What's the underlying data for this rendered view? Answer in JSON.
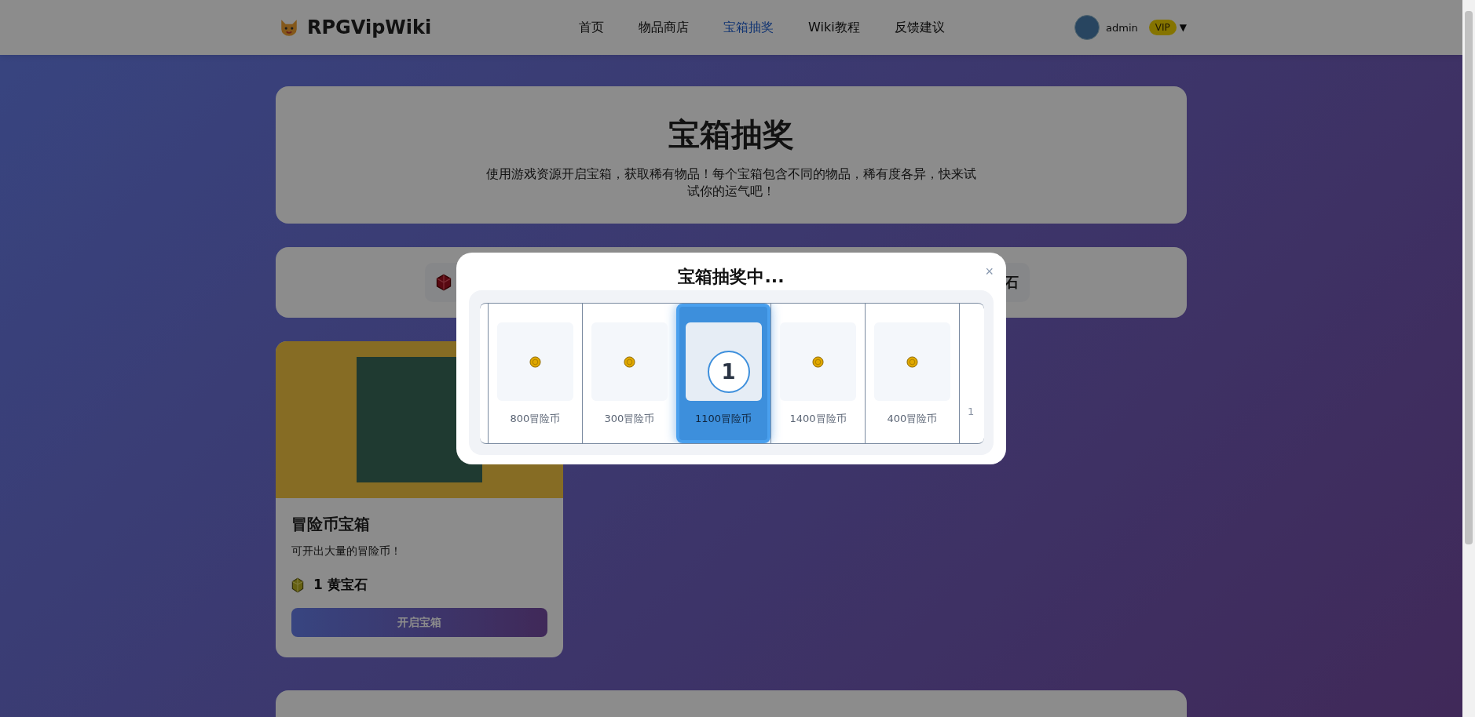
{
  "header": {
    "logo": "RPGVipWiki",
    "nav": [
      {
        "label": "首页",
        "selected": false
      },
      {
        "label": "物品商店",
        "selected": false
      },
      {
        "label": "宝箱抽奖",
        "selected": true
      },
      {
        "label": "Wiki教程",
        "selected": false
      },
      {
        "label": "反馈建议",
        "selected": false
      }
    ],
    "user": {
      "name": "admin",
      "badge": "VIP",
      "caret": "▼"
    }
  },
  "intro": {
    "title": "宝箱抽奖",
    "description": "使用游戏资源开启宝箱，获取稀有物品！每个宝箱包含不同的物品，稀有度各异，快来试试你的运气吧！"
  },
  "resource_bar": {
    "items": [
      {
        "kind": "ruby"
      },
      {
        "kind": "text",
        "label": "石"
      }
    ]
  },
  "chests": [
    {
      "title": "冒险币宝箱",
      "description": "可开出大量的冒险币！",
      "price": "1 黄宝石",
      "button": "开启宝箱"
    }
  ],
  "modal": {
    "title": "宝箱抽奖中...",
    "close": "×",
    "items": [
      {
        "kind": "full",
        "label": "800冒险币",
        "selected": false
      },
      {
        "kind": "full",
        "label": "300冒险币",
        "selected": false
      },
      {
        "kind": "full",
        "label": "1100冒险币",
        "selected": true,
        "badge": "1"
      },
      {
        "kind": "full",
        "label": "1400冒险币",
        "selected": false
      },
      {
        "kind": "full",
        "label": "400冒险币",
        "selected": false
      },
      {
        "kind": "partial",
        "label": "1",
        "selected": false
      }
    ]
  }
}
